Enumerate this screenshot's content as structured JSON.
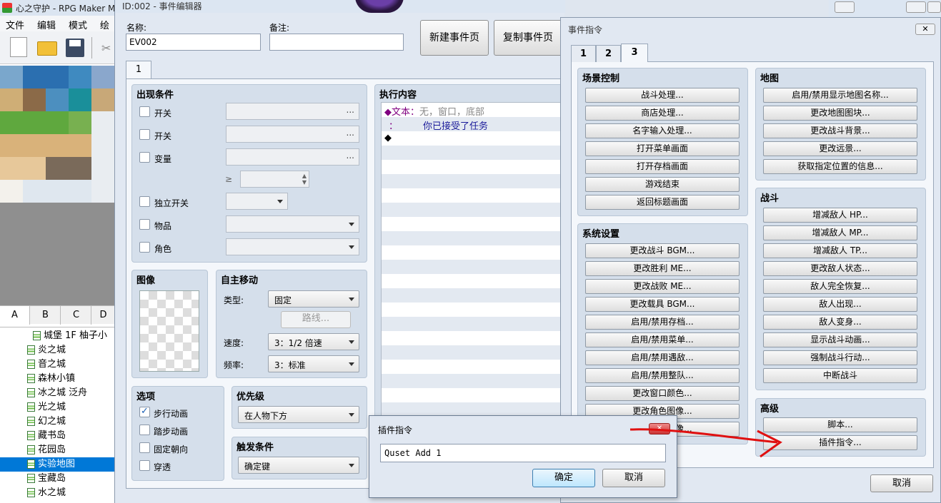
{
  "main_window": {
    "title": "心之守护 - RPG Maker M",
    "menu": [
      "文件",
      "编辑",
      "模式",
      "绘图"
    ],
    "tile_tabs": [
      "A",
      "B",
      "C",
      "D"
    ],
    "maps": [
      {
        "label": "城堡 1F 柚子小",
        "selected": false,
        "indent": 1
      },
      {
        "label": "炎之城",
        "selected": false,
        "indent": 0
      },
      {
        "label": "音之城",
        "selected": false,
        "indent": 0
      },
      {
        "label": "森林小镇",
        "selected": false,
        "indent": 0
      },
      {
        "label": "冰之城 泛舟",
        "selected": false,
        "indent": 0
      },
      {
        "label": "光之城",
        "selected": false,
        "indent": 0
      },
      {
        "label": "幻之城",
        "selected": false,
        "indent": 0
      },
      {
        "label": "藏书岛",
        "selected": false,
        "indent": 0
      },
      {
        "label": "花园岛",
        "selected": false,
        "indent": 0
      },
      {
        "label": "实验地图",
        "selected": true,
        "indent": 0
      },
      {
        "label": "宝藏岛",
        "selected": false,
        "indent": 0
      },
      {
        "label": "水之城",
        "selected": false,
        "indent": 0
      }
    ]
  },
  "event_editor": {
    "title": "ID:002 - 事件编辑器",
    "name_label": "名称:",
    "name_value": "EV002",
    "note_label": "备注:",
    "note_value": "",
    "new_page_btn": "新建事件页",
    "copy_page_btn": "复制事件页",
    "page_tab": "1",
    "conditions": {
      "title": "出现条件",
      "items": [
        "开关",
        "开关",
        "变量",
        "独立开关",
        "物品",
        "角色"
      ],
      "ellipsis": "...",
      "gte": "≥"
    },
    "image": {
      "title": "图像"
    },
    "autonomous": {
      "title": "自主移动",
      "type_label": "类型:",
      "type_value": "固定",
      "route_btn": "路线...",
      "speed_label": "速度:",
      "speed_value": "3：1/2 倍速",
      "freq_label": "频率:",
      "freq_value": "3：标准"
    },
    "options": {
      "title": "选项",
      "items": [
        {
          "label": "步行动画",
          "checked": true
        },
        {
          "label": "踏步动画",
          "checked": false
        },
        {
          "label": "固定朝向",
          "checked": false
        },
        {
          "label": "穿透",
          "checked": false
        }
      ]
    },
    "priority": {
      "title": "优先级",
      "value": "在人物下方"
    },
    "trigger": {
      "title": "触发条件",
      "value": "确定键"
    },
    "contents": {
      "title": "执行内容",
      "line1_prefix": "◆文本：",
      "line1_rest": "无，窗口，底部",
      "line2_prefix": "：",
      "line2_rest": "你已接受了任务",
      "line3": "◆"
    }
  },
  "event_commands": {
    "title": "事件指令",
    "tabs": [
      "1",
      "2",
      "3"
    ],
    "active_tab": "3",
    "scene_control": {
      "title": "场景控制",
      "buttons": [
        "战斗处理...",
        "商店处理...",
        "名字输入处理...",
        "打开菜单画面",
        "打开存档画面",
        "游戏结束",
        "返回标题画面"
      ]
    },
    "system_settings": {
      "title": "系统设置",
      "buttons": [
        "更改战斗 BGM...",
        "更改胜利 ME...",
        "更改战败 ME...",
        "更改载具 BGM...",
        "启用/禁用存档...",
        "启用/禁用菜单...",
        "启用/禁用遇敌...",
        "启用/禁用整队...",
        "更改窗口颜色...",
        "更改角色图像...",
        "更改载具图像..."
      ]
    },
    "map": {
      "title": "地图",
      "buttons": [
        "启用/禁用显示地图名称...",
        "更改地图图块...",
        "更改战斗背景...",
        "更改远景...",
        "获取指定位置的信息..."
      ]
    },
    "battle": {
      "title": "战斗",
      "buttons": [
        "增减敌人 HP...",
        "增减敌人 MP...",
        "增减敌人 TP...",
        "更改敌人状态...",
        "敌人完全恢复...",
        "敌人出现...",
        "敌人变身...",
        "显示战斗动画...",
        "强制战斗行动...",
        "中断战斗"
      ]
    },
    "advanced": {
      "title": "高级",
      "buttons": [
        "脚本...",
        "插件指令..."
      ]
    },
    "cancel_btn": "取消"
  },
  "plugin_dialog": {
    "title": "插件指令",
    "input_value": "Quset Add 1",
    "ok_btn": "确定",
    "cancel_btn": "取消"
  }
}
